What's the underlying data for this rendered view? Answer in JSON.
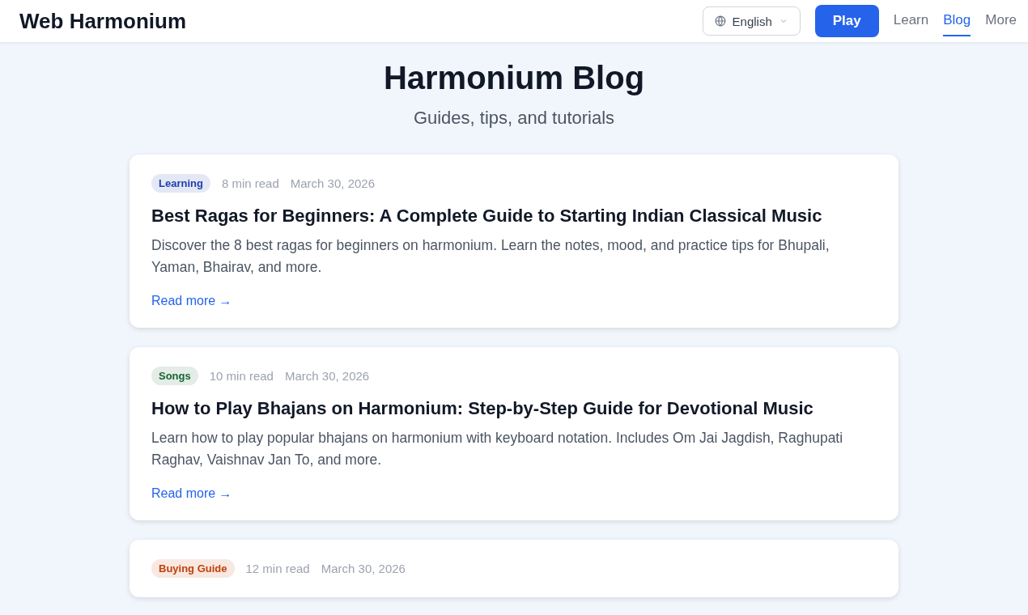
{
  "header": {
    "brand": "Web Harmonium",
    "language": "English",
    "play_button": "Play",
    "nav": [
      {
        "label": "Learn",
        "selected": false
      },
      {
        "label": "Blog",
        "selected": true
      },
      {
        "label": "More",
        "selected": false
      }
    ]
  },
  "hero": {
    "title": "Harmonium Blog",
    "subtitle": "Guides, tips, and tutorials"
  },
  "posts": [
    {
      "tag": "Learning",
      "color": "#1e40af",
      "read_time": "8 min read",
      "date": "March 30, 2026",
      "title": "Best Ragas for Beginners: A Complete Guide to Starting Indian Classical Music",
      "excerpt": "Discover the 8 best ragas for beginners on harmonium. Learn the notes, mood, and practice tips for Bhupali, Yaman, Bhairav, and more.",
      "link": "Read more →"
    },
    {
      "tag": "Songs",
      "color": "#166534",
      "read_time": "10 min read",
      "date": "March 30, 2026",
      "title": "How to Play Bhajans on Harmonium: Step-by-Step Guide for Devotional Music",
      "excerpt": "Learn how to play popular bhajans on harmonium with keyboard notation. Includes Om Jai Jagdish, Raghupati Raghav, Vaishnav Jan To, and more.",
      "link": "Read more →"
    },
    {
      "tag": "Buying Guide",
      "color": "#c2410c",
      "read_time": "12 min read",
      "date": "March 30, 2026"
    }
  ]
}
